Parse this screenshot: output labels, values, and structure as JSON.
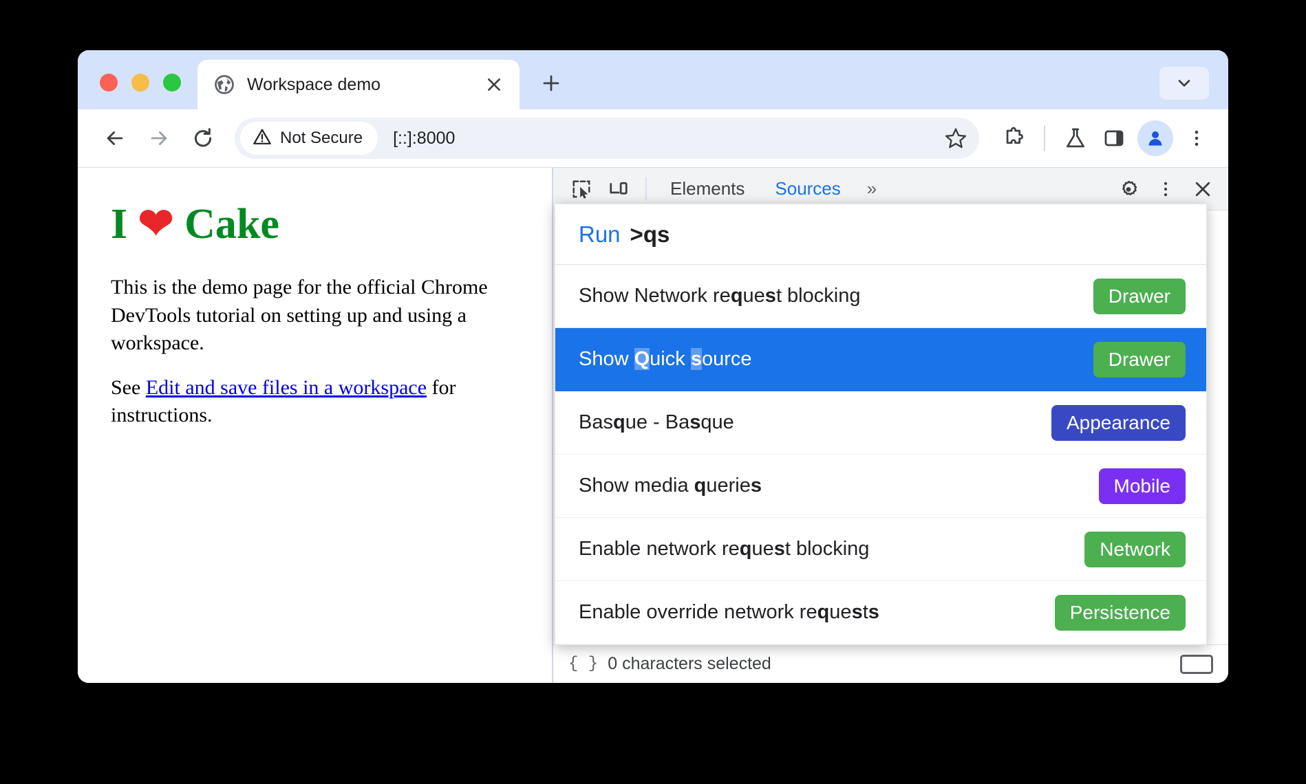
{
  "browser": {
    "tab": {
      "title": "Workspace demo",
      "favicon": "globe-icon",
      "close": "×",
      "newtab": "+"
    },
    "toolbar": {
      "back": "←",
      "forward": "→",
      "reload": "⟳",
      "security_label": "Not Secure",
      "security_icon": "warning-triangle-icon",
      "url": "[::]:8000",
      "bookmark": "☆",
      "extensions": "puzzle-icon",
      "labs": "flask-icon",
      "side_panel": "split-panel-icon",
      "profile": "avatar-icon",
      "menu": "three-dots-icon"
    },
    "tabstrip_caret": "chevron-down-icon"
  },
  "page": {
    "heading_prefix": "I ",
    "heading_heart": "❤",
    "heading_suffix": " Cake",
    "paragraph1": "This is the demo page for the official Chrome DevTools tutorial on setting up and using a workspace.",
    "paragraph2_before": "See ",
    "paragraph2_link": "Edit and save files in a workspace",
    "paragraph2_after": " for instructions."
  },
  "devtools": {
    "toolbar": {
      "inspect_icon": "inspect-cursor-icon",
      "device_icon": "device-toolbar-icon",
      "tabs": [
        {
          "label": "Elements",
          "active": false
        },
        {
          "label": "Sources",
          "active": true
        }
      ],
      "more_tabs": "»",
      "settings_icon": "gear-icon",
      "menu_icon": "three-dots-icon",
      "close_icon": "close-icon"
    },
    "statusbar": {
      "icon": "{ }",
      "text": "0 characters selected",
      "kbd": "keyboard-icon"
    },
    "command_palette": {
      "run_label": "Run",
      "query": ">qs",
      "placeholder": "Run >",
      "items": [
        {
          "title": "Show Network request blocking",
          "parts": [
            {
              "t": "Show Network re",
              "b": false
            },
            {
              "t": "q",
              "b": true
            },
            {
              "t": "ue",
              "b": false
            },
            {
              "t": "s",
              "b": true
            },
            {
              "t": "t blocking",
              "b": false
            }
          ],
          "badge": "Drawer",
          "badge_color": "#4caf50",
          "selected": false
        },
        {
          "title": "Show Quick source",
          "parts": [
            {
              "t": "Show ",
              "b": false
            },
            {
              "t": "Q",
              "b": true
            },
            {
              "t": "uick ",
              "b": false
            },
            {
              "t": "s",
              "b": true
            },
            {
              "t": "ource",
              "b": false
            }
          ],
          "badge": "Drawer",
          "badge_color": "#4caf50",
          "selected": true
        },
        {
          "title": "Basque - Basque",
          "parts": [
            {
              "t": "Bas",
              "b": false
            },
            {
              "t": "q",
              "b": true
            },
            {
              "t": "ue - Ba",
              "b": false
            },
            {
              "t": "s",
              "b": true
            },
            {
              "t": "que",
              "b": false
            }
          ],
          "badge": "Appearance",
          "badge_color": "#3949c4",
          "selected": false
        },
        {
          "title": "Show media queries",
          "parts": [
            {
              "t": "Show media ",
              "b": false
            },
            {
              "t": "q",
              "b": true
            },
            {
              "t": "uerie",
              "b": false
            },
            {
              "t": "s",
              "b": true
            }
          ],
          "badge": "Mobile",
          "badge_color": "#7b2ff2",
          "selected": false
        },
        {
          "title": "Enable network request blocking",
          "parts": [
            {
              "t": "Enable network re",
              "b": false
            },
            {
              "t": "q",
              "b": true
            },
            {
              "t": "ue",
              "b": false
            },
            {
              "t": "s",
              "b": true
            },
            {
              "t": "t blocking",
              "b": false
            }
          ],
          "badge": "Network",
          "badge_color": "#4caf50",
          "selected": false
        },
        {
          "title": "Enable override network requests",
          "parts": [
            {
              "t": "Enable override network re",
              "b": false
            },
            {
              "t": "q",
              "b": true
            },
            {
              "t": "ue",
              "b": false
            },
            {
              "t": "s",
              "b": true
            },
            {
              "t": "t",
              "b": false
            },
            {
              "t": "s",
              "b": true
            }
          ],
          "badge": "Persistence",
          "badge_color": "#4caf50",
          "selected": false
        }
      ]
    }
  },
  "colors": {
    "accent_blue": "#1a73e8",
    "tabstrip_blue": "#d5e2fb",
    "page_green": "#008a20",
    "link_blue": "#0000ee"
  }
}
